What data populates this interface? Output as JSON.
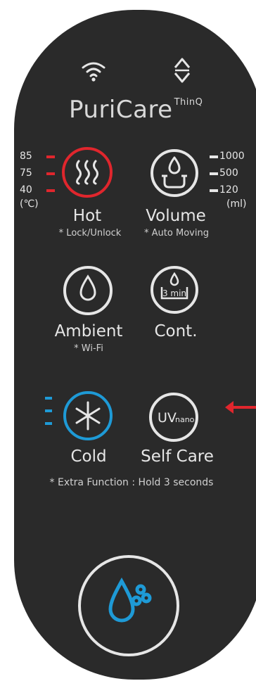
{
  "brand": {
    "name": "PuriCare",
    "suffix": "ThinQ"
  },
  "temperature": {
    "levels": [
      "85",
      "75",
      "40"
    ],
    "unit": "(℃)"
  },
  "volume": {
    "levels": [
      "1000",
      "500",
      "120"
    ],
    "unit": "(ml)"
  },
  "buttons": {
    "hot": {
      "label": "Hot",
      "note": "* Lock/Unlock"
    },
    "volume": {
      "label": "Volume",
      "note": "* Auto Moving"
    },
    "ambient": {
      "label": "Ambient",
      "note": "* Wi-Fi"
    },
    "cont": {
      "label": "Cont.",
      "icon_text": "3 min"
    },
    "cold": {
      "label": "Cold"
    },
    "selfcare": {
      "label": "Self Care",
      "icon_text": "UV",
      "icon_sub": "nano"
    }
  },
  "extra_note": "* Extra Function : Hold 3 seconds",
  "colors": {
    "panel": "#2a2a2a",
    "hot": "#e0262d",
    "cold": "#1e9ad6",
    "indicator_red": "#e0262d",
    "indicator_blue": "#1e9ad6",
    "arrow": "#e0262d"
  }
}
